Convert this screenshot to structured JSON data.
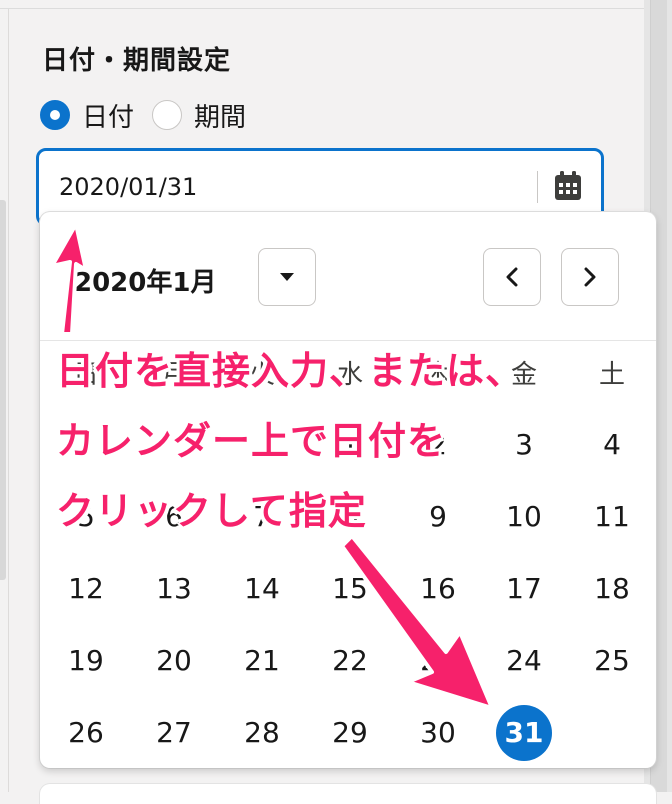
{
  "section": {
    "title": "日付・期間設定"
  },
  "mode": {
    "options": [
      {
        "label": "日付",
        "checked": true
      },
      {
        "label": "期間",
        "checked": false
      }
    ]
  },
  "date_input": {
    "value": "2020/01/31",
    "icon": "calendar-icon"
  },
  "calendar": {
    "month_label": "2020年1月",
    "weekdays": [
      "日",
      "月",
      "火",
      "水",
      "木",
      "金",
      "土"
    ],
    "days": [
      [
        "",
        "",
        "",
        "1",
        "2",
        "3",
        "4"
      ],
      [
        "5",
        "6",
        "7",
        "8",
        "9",
        "10",
        "11"
      ],
      [
        "12",
        "13",
        "14",
        "15",
        "16",
        "17",
        "18"
      ],
      [
        "19",
        "20",
        "21",
        "22",
        "23",
        "24",
        "25"
      ],
      [
        "26",
        "27",
        "28",
        "29",
        "30",
        "31",
        ""
      ]
    ],
    "selected_day": "31"
  },
  "annotation": {
    "lines": [
      "日付を直接入力、または、",
      "カレンダー上で日付を",
      "クリックして指定"
    ],
    "color": "#f6216b"
  },
  "colors": {
    "accent": "#0b73cc"
  }
}
